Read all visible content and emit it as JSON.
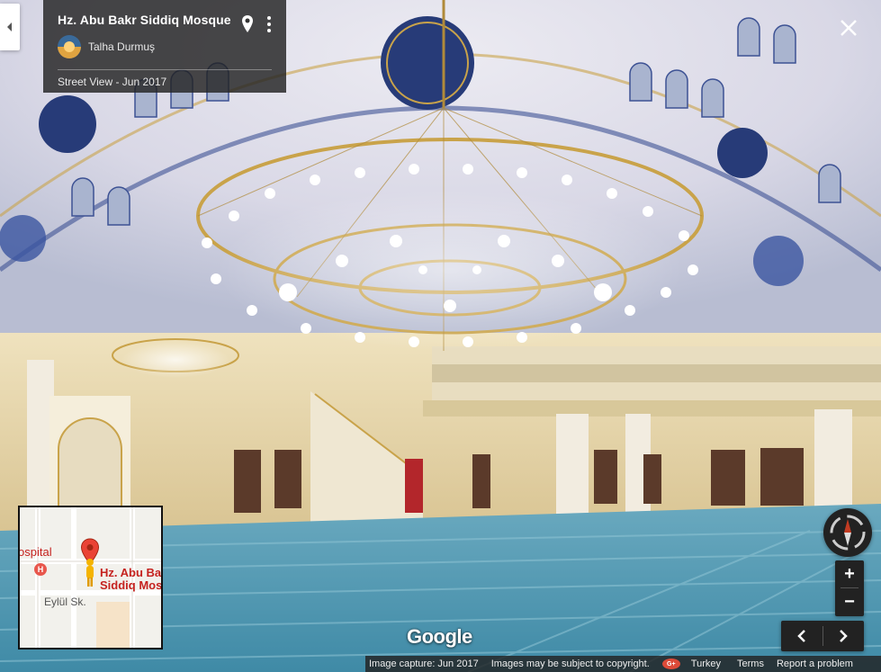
{
  "place": {
    "title": "Hz. Abu Bakr Siddiq Mosque",
    "author": "Talha Durmuş",
    "date_line": "Street View - Jun 2017"
  },
  "minimap": {
    "hospital_label": "ospital",
    "hospital_marker": "H",
    "place_line1": "Hz. Abu Ba",
    "place_line2": "Siddiq Mos",
    "street_label": "Eylül Sk."
  },
  "logo": "Google",
  "attribution": {
    "capture": "Image capture: Jun 2017",
    "copyright": "Images may be subject to copyright.",
    "gplus": "G+",
    "country": "Turkey",
    "terms": "Terms",
    "report": "Report a problem"
  },
  "controls": {
    "zoom_in": "+",
    "zoom_out": "−"
  },
  "icons": {
    "collapse": "chevron-left-icon",
    "pin": "location-pin-icon",
    "more": "more-vert-icon",
    "close": "close-icon",
    "compass": "compass-icon",
    "prev": "chevron-left-icon",
    "next": "chevron-right-icon"
  },
  "colors": {
    "dome": "#e9e9f1",
    "ornament_blue": "#2a3f7a",
    "gold": "#c9a34a",
    "carpet": "#4e9ab3",
    "wall": "#e4d2a6",
    "panel": "#222222",
    "map_red": "#c5221f",
    "pegman": "#f5b400"
  }
}
